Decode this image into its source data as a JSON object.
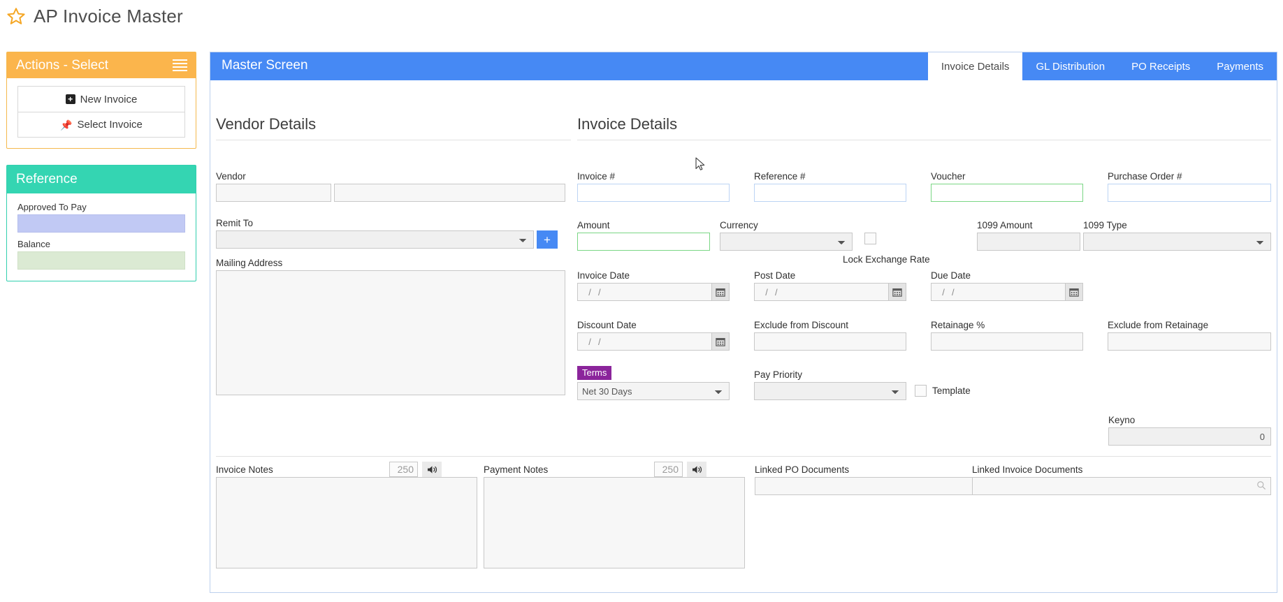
{
  "app": {
    "title": "AP Invoice Master",
    "star_icon": "star-icon"
  },
  "sidebar": {
    "actions_panel": {
      "title": "Actions - Select",
      "menu_icon": "hamburger-icon",
      "items": [
        {
          "label": "New Invoice",
          "icon": "plus-square-icon"
        },
        {
          "label": "Select Invoice",
          "icon": "pin-icon"
        }
      ]
    },
    "reference_panel": {
      "title": "Reference",
      "fields": [
        {
          "label": "Approved To Pay",
          "value": ""
        },
        {
          "label": "Balance",
          "value": ""
        }
      ]
    }
  },
  "main": {
    "header_title": "Master Screen",
    "tabs": [
      {
        "label": "Invoice Details",
        "active": true
      },
      {
        "label": "GL Distribution",
        "active": false
      },
      {
        "label": "PO Receipts",
        "active": false
      },
      {
        "label": "Payments",
        "active": false
      }
    ],
    "vendor_section": {
      "title": "Vendor Details",
      "vendor_label": "Vendor",
      "vendor_code_value": "",
      "vendor_name_value": "",
      "remit_to_label": "Remit To",
      "remit_to_value": "",
      "add_remit_icon": "plus-icon",
      "mailing_address_label": "Mailing Address",
      "mailing_address_value": ""
    },
    "invoice_section": {
      "title": "Invoice Details",
      "invoice_number_label": "Invoice #",
      "invoice_number_value": "",
      "reference_number_label": "Reference #",
      "reference_number_value": "",
      "voucher_label": "Voucher",
      "voucher_value": "",
      "purchase_order_label": "Purchase Order #",
      "purchase_order_value": "",
      "amount_label": "Amount",
      "amount_value": "",
      "currency_label": "Currency",
      "currency_value": "",
      "lock_exchange_rate_label": "Lock Exchange Rate",
      "lock_exchange_rate_checked": false,
      "amount_1099_label": "1099 Amount",
      "amount_1099_value": "",
      "type_1099_label": "1099 Type",
      "type_1099_value": "",
      "invoice_date_label": "Invoice Date",
      "invoice_date_value": "  /  /",
      "post_date_label": "Post Date",
      "post_date_value": "  /  /",
      "due_date_label": "Due Date",
      "due_date_value": "  /  /",
      "discount_date_label": "Discount Date",
      "discount_date_value": "  /  /",
      "exclude_from_discount_label": "Exclude from Discount",
      "exclude_from_discount_value": "",
      "retainage_label": "Retainage %",
      "retainage_value": "",
      "exclude_from_retainage_label": "Exclude from Retainage",
      "exclude_from_retainage_value": "",
      "terms_label": "Terms",
      "terms_value": "Net 30 Days",
      "pay_priority_label": "Pay Priority",
      "pay_priority_value": "",
      "template_label": "Template",
      "template_checked": false,
      "keyno_label": "Keyno",
      "keyno_value": "0",
      "calendar_icon": "calendar-icon"
    },
    "notes_section": {
      "invoice_notes_label": "Invoice Notes",
      "invoice_notes_value": "",
      "invoice_notes_count": "250",
      "payment_notes_label": "Payment Notes",
      "payment_notes_value": "",
      "payment_notes_count": "250",
      "speaker_icon": "speaker-icon",
      "linked_po_documents_label": "Linked PO Documents",
      "linked_po_documents_value": "",
      "linked_invoice_documents_label": "Linked Invoice Documents",
      "linked_invoice_documents_value": "",
      "search_icon": "search-icon"
    }
  },
  "colors": {
    "accent_blue": "#4689f4",
    "actions_orange": "#fbb54c",
    "reference_teal": "#34d5b2",
    "terms_purple": "#8b259b",
    "green_border": "#7ad684",
    "approved_fill": "#c1c9f4",
    "balance_fill": "#dbead3"
  }
}
